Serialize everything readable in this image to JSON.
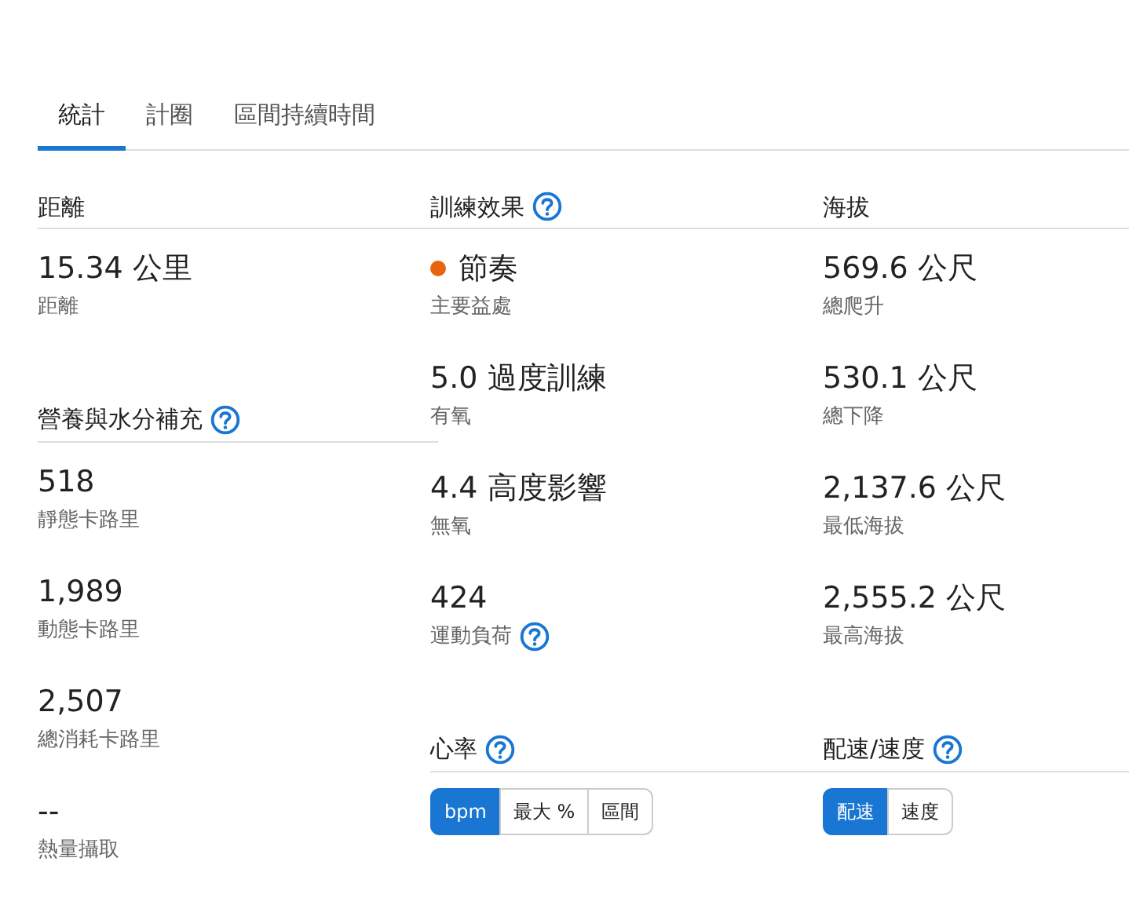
{
  "tabs": [
    {
      "label": "統計",
      "selected": true
    },
    {
      "label": "計圈",
      "selected": false
    },
    {
      "label": "區間持續時間",
      "selected": false
    }
  ],
  "columns": [
    {
      "sections": [
        {
          "title": "距離",
          "help": false,
          "stats": [
            {
              "value": "15.34 公里",
              "label": "距離"
            }
          ]
        },
        {
          "title": "營養與水分補充",
          "help": true,
          "stats": [
            {
              "value": "518",
              "label": "靜態卡路里"
            },
            {
              "value": "1,989",
              "label": "動態卡路里"
            },
            {
              "value": "2,507",
              "label": "總消耗卡路里"
            },
            {
              "value": "--",
              "label": "熱量攝取"
            }
          ]
        }
      ]
    },
    {
      "sections": [
        {
          "title": "訓練效果",
          "help": true,
          "stats": [
            {
              "value": "節奏",
              "label": "主要益處",
              "color": "#e8650f"
            },
            {
              "value": "5.0 過度訓練",
              "label": "有氧"
            },
            {
              "value": "4.4 高度影響",
              "label": "無氧"
            },
            {
              "value": "424",
              "label": "運動負荷",
              "help": true
            }
          ]
        },
        {
          "title": "心率",
          "help": true,
          "toggles": [
            {
              "label": "bpm",
              "selected": true
            },
            {
              "label": "最大 %",
              "selected": false
            },
            {
              "label": "區間",
              "selected": false
            }
          ]
        }
      ]
    },
    {
      "sections": [
        {
          "title": "海拔",
          "help": false,
          "stats": [
            {
              "value": "569.6 公尺",
              "label": "總爬升"
            },
            {
              "value": "530.1 公尺",
              "label": "總下降"
            },
            {
              "value": "2,137.6 公尺",
              "label": "最低海拔"
            },
            {
              "value": "2,555.2 公尺",
              "label": "最高海拔"
            }
          ]
        },
        {
          "title": "配速/速度",
          "help": true,
          "toggles": [
            {
              "label": "配速",
              "selected": true
            },
            {
              "label": "速度",
              "selected": false
            }
          ]
        }
      ]
    }
  ]
}
